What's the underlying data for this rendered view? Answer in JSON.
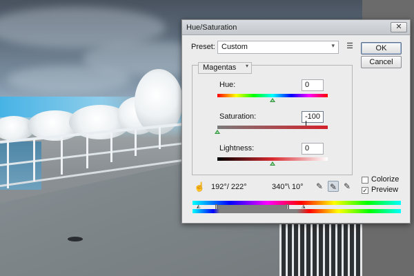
{
  "dialog": {
    "title": "Hue/Saturation",
    "close_glyph": "✕",
    "preset_label": "Preset:",
    "preset_value": "Custom",
    "ok_label": "OK",
    "cancel_label": "Cancel",
    "range_value": "Magentas",
    "hue": {
      "label": "Hue:",
      "value": "0",
      "slider_value": 0,
      "slider_min": -180,
      "slider_max": 180
    },
    "saturation": {
      "label": "Saturation:",
      "value": "-100",
      "slider_value": -100,
      "slider_min": -100,
      "slider_max": 100
    },
    "lightness": {
      "label": "Lightness:",
      "value": "0",
      "slider_value": 0,
      "slider_min": -100,
      "slider_max": 100
    },
    "range_left_readout": "192°/ 222°",
    "range_right_readout": "340°\\ 10°",
    "colorize_label": "Colorize",
    "colorize_checked": false,
    "preview_label": "Preview",
    "preview_checked": true,
    "check_glyph": "✓"
  },
  "icons": {
    "hand": "hand-icon",
    "eyedropper": "eyedropper-icon",
    "eyedropper_plus": "eyedropper-plus-icon",
    "eyedropper_minus": "eyedropper-minus-icon",
    "preset_menu": "preset-menu-icon"
  },
  "colors": {
    "thumb": "#2f8f3a",
    "saturation_bar_end": "#d3202a"
  }
}
